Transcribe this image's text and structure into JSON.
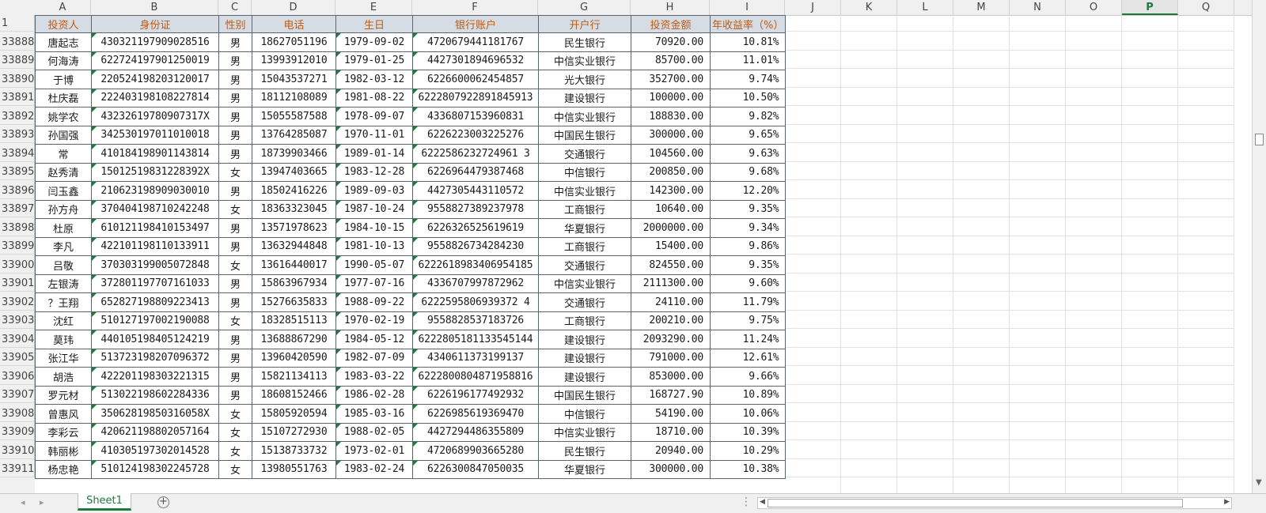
{
  "columns": [
    "A",
    "B",
    "C",
    "D",
    "E",
    "F",
    "G",
    "H",
    "I",
    "J",
    "K",
    "L",
    "M",
    "N",
    "O",
    "P",
    "Q"
  ],
  "selected_column": "P",
  "header_row_number": "1",
  "headers": [
    "投资人",
    "身份证",
    "性别",
    "电话",
    "生日",
    "银行账户",
    "开户行",
    "投资金额",
    "年收益率（%）"
  ],
  "rows": [
    {
      "row": "33888",
      "name": "唐起志",
      "id": "430321197909028516",
      "gender": "男",
      "phone": "18627051196",
      "birthday": "1979-09-02",
      "account": "4720679441181767",
      "bank": "民生银行",
      "amount": "70920.00",
      "rate": "10.81%"
    },
    {
      "row": "33889",
      "name": "何海涛",
      "id": "622724197901250019",
      "gender": "男",
      "phone": "13993912010",
      "birthday": "1979-01-25",
      "account": "4427301894696532",
      "bank": "中信实业银行",
      "amount": "85700.00",
      "rate": "11.01%"
    },
    {
      "row": "33890",
      "name": "于博",
      "id": "220524198203120017",
      "gender": "男",
      "phone": "15043537271",
      "birthday": "1982-03-12",
      "account": "6226600062454857",
      "bank": "光大银行",
      "amount": "352700.00",
      "rate": "9.74%"
    },
    {
      "row": "33891",
      "name": "杜庆磊",
      "id": "222403198108227814",
      "gender": "男",
      "phone": "18112108089",
      "birthday": "1981-08-22",
      "account": "6222807922891845913",
      "bank": "建设银行",
      "amount": "100000.00",
      "rate": "10.50%"
    },
    {
      "row": "33892",
      "name": "姚学农",
      "id": "43232619780907317X",
      "gender": "男",
      "phone": "15055587588",
      "birthday": "1978-09-07",
      "account": "4336807153960831",
      "bank": "中信实业银行",
      "amount": "188830.00",
      "rate": "9.82%"
    },
    {
      "row": "33893",
      "name": "孙国强",
      "id": "342530197011010018",
      "gender": "男",
      "phone": "13764285087",
      "birthday": "1970-11-01",
      "account": "6226223003225276",
      "bank": "中国民生银行",
      "amount": "300000.00",
      "rate": "9.65%"
    },
    {
      "row": "33894",
      "name": "常",
      "id": "410184198901143814",
      "gender": "男",
      "phone": "18739903466",
      "birthday": "1989-01-14",
      "account": "6222586232724961 3",
      "bank": "交通银行",
      "amount": "104560.00",
      "rate": "9.63%"
    },
    {
      "row": "33895",
      "name": "赵秀清",
      "id": "15012519831228392X",
      "gender": "女",
      "phone": "13947403665",
      "birthday": "1983-12-28",
      "account": "6226964479387468",
      "bank": "中信银行",
      "amount": "200850.00",
      "rate": "9.68%"
    },
    {
      "row": "33896",
      "name": "闫玉鑫",
      "id": "210623198909030010",
      "gender": "男",
      "phone": "18502416226",
      "birthday": "1989-09-03",
      "account": "4427305443110572",
      "bank": "中信实业银行",
      "amount": "142300.00",
      "rate": "12.20%"
    },
    {
      "row": "33897",
      "name": "孙方舟",
      "id": "370404198710242248",
      "gender": "女",
      "phone": "18363323045",
      "birthday": "1987-10-24",
      "account": "9558827389237978",
      "bank": "工商银行",
      "amount": "10640.00",
      "rate": "9.35%"
    },
    {
      "row": "33898",
      "name": "杜原",
      "id": "610121198410153497",
      "gender": "男",
      "phone": "13571978623",
      "birthday": "1984-10-15",
      "account": "6226326525619619",
      "bank": "华夏银行",
      "amount": "2000000.00",
      "rate": "9.34%"
    },
    {
      "row": "33899",
      "name": "李凡",
      "id": "422101198110133911",
      "gender": "男",
      "phone": "13632944848",
      "birthday": "1981-10-13",
      "account": "9558826734284230",
      "bank": "工商银行",
      "amount": "15400.00",
      "rate": "9.86%"
    },
    {
      "row": "33900",
      "name": "吕敬",
      "id": "370303199005072848",
      "gender": "女",
      "phone": "13616440017",
      "birthday": "1990-05-07",
      "account": "6222618983406954185",
      "bank": "交通银行",
      "amount": "824550.00",
      "rate": "9.35%"
    },
    {
      "row": "33901",
      "name": "左银涛",
      "id": "372801197707161033",
      "gender": "男",
      "phone": "15863967934",
      "birthday": "1977-07-16",
      "account": "4336707997872962",
      "bank": "中信实业银行",
      "amount": "2111300.00",
      "rate": "9.60%"
    },
    {
      "row": "33902",
      "name": "？王翔",
      "id": "652827198809223413",
      "gender": "男",
      "phone": "15276635833",
      "birthday": "1988-09-22",
      "account": "6222595806939372 4",
      "bank": "交通银行",
      "amount": "24110.00",
      "rate": "11.79%"
    },
    {
      "row": "33903",
      "name": "沈红",
      "id": "510127197002190088",
      "gender": "女",
      "phone": "18328515113",
      "birthday": "1970-02-19",
      "account": "9558828537183726",
      "bank": "工商银行",
      "amount": "200210.00",
      "rate": "9.75%"
    },
    {
      "row": "33904",
      "name": "莫玮",
      "id": "440105198405124219",
      "gender": "男",
      "phone": "13688867290",
      "birthday": "1984-05-12",
      "account": "6222805181133545144",
      "bank": "建设银行",
      "amount": "2093290.00",
      "rate": "11.24%"
    },
    {
      "row": "33905",
      "name": "张江华",
      "id": "513723198207096372",
      "gender": "男",
      "phone": "13960420590",
      "birthday": "1982-07-09",
      "account": "4340611373199137",
      "bank": "建设银行",
      "amount": "791000.00",
      "rate": "12.61%"
    },
    {
      "row": "33906",
      "name": "胡浩",
      "id": "422201198303221315",
      "gender": "男",
      "phone": "15821134113",
      "birthday": "1983-03-22",
      "account": "6222800804871958816",
      "bank": "建设银行",
      "amount": "853000.00",
      "rate": "9.66%"
    },
    {
      "row": "33907",
      "name": "罗元材",
      "id": "513022198602284336",
      "gender": "男",
      "phone": "18608152466",
      "birthday": "1986-02-28",
      "account": "6226196177492932",
      "bank": "中国民生银行",
      "amount": "168727.90",
      "rate": "10.89%"
    },
    {
      "row": "33908",
      "name": "曾惠风",
      "id": "35062819850316058X",
      "gender": "女",
      "phone": "15805920594",
      "birthday": "1985-03-16",
      "account": "6226985619369470",
      "bank": "中信银行",
      "amount": "54190.00",
      "rate": "10.06%"
    },
    {
      "row": "33909",
      "name": "李彩云",
      "id": "420621198802057164",
      "gender": "女",
      "phone": "15107272930",
      "birthday": "1988-02-05",
      "account": "4427294486355809",
      "bank": "中信实业银行",
      "amount": "18710.00",
      "rate": "10.39%"
    },
    {
      "row": "33910",
      "name": "韩丽彬",
      "id": "410305197302014528",
      "gender": "女",
      "phone": "15138733732",
      "birthday": "1973-02-01",
      "account": "4720689903665280",
      "bank": "民生银行",
      "amount": "20940.00",
      "rate": "10.29%"
    },
    {
      "row": "33911",
      "name": "杨忠艳",
      "id": "510124198302245728",
      "gender": "女",
      "phone": "13980551763",
      "birthday": "1983-02-24",
      "account": "6226300847050035",
      "bank": "华夏银行",
      "amount": "300000.00",
      "rate": "10.38%"
    }
  ],
  "sheet_tab": "Sheet1",
  "add_sheet": "+",
  "nav": {
    "prev": "◂",
    "next": "▸",
    "more": "⋮"
  },
  "icons": {
    "add_sheet": "plus-circle-icon",
    "scroll_left": "triangle-left-icon",
    "scroll_right": "triangle-right-icon",
    "scroll_down": "triangle-down-icon"
  },
  "colors": {
    "header_fill": "#d6dce4",
    "header_text": "#c05a11",
    "accent": "#1f7a3d",
    "border": "#5a6472"
  }
}
